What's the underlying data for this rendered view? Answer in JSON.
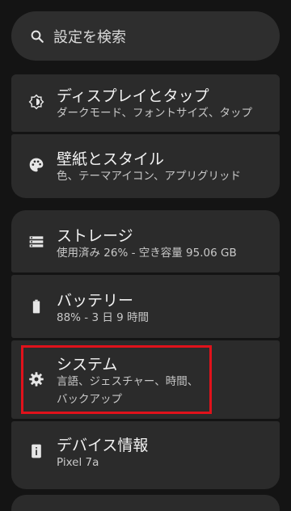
{
  "search": {
    "placeholder": "設定を検索",
    "icon": "search-icon"
  },
  "items": [
    {
      "title": "ディスプレイとタップ",
      "subtitle": "ダークモード、フォントサイズ、タップ",
      "icon": "display-icon"
    },
    {
      "title": "壁紙とスタイル",
      "subtitle": "色、テーマアイコン、アプリグリッド",
      "icon": "palette-icon"
    },
    {
      "title": "ストレージ",
      "subtitle": "使用済み 26% - 空き容量 95.06 GB",
      "icon": "storage-icon"
    },
    {
      "title": "バッテリー",
      "subtitle": "88% - 3 日 9 時間",
      "icon": "battery-icon"
    },
    {
      "title": "システム",
      "subtitle_line1": "言語、ジェスチャー、時間、",
      "subtitle_line2": "バックアップ",
      "icon": "gear-icon"
    },
    {
      "title": "デバイス情報",
      "subtitle": "Pixel 7a",
      "icon": "info-icon"
    }
  ],
  "colors": {
    "background": "#141414",
    "card": "#2b2b2b",
    "highlight": "#e0121b"
  }
}
